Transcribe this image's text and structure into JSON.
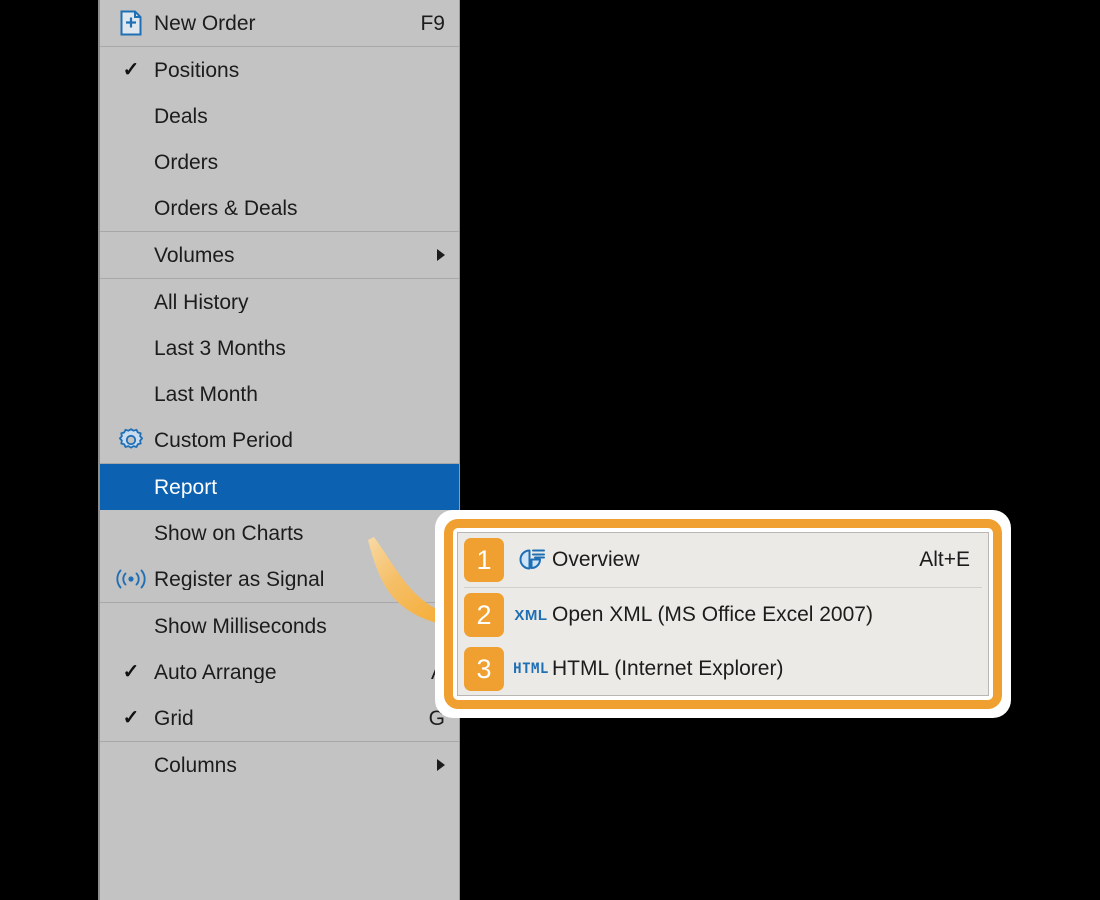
{
  "colors": {
    "menu_background": "#c3c3c3",
    "menu_separator": "#a8a8a8",
    "selection_blue": "#0c62b0",
    "accent_orange": "#f0a030",
    "icon_blue": "#1f6fb5",
    "submenu_background": "#eceae6",
    "canvas_black": "#000000",
    "text": "#1c1c1c"
  },
  "menu": {
    "name": "trade-context-menu",
    "groups": [
      {
        "items": [
          {
            "label": "New Order",
            "accel": "F9",
            "icon": "new-document-plus-icon",
            "checked": false,
            "submenu": false,
            "selected": false
          }
        ]
      },
      {
        "items": [
          {
            "label": "Positions",
            "accel": "",
            "icon": "",
            "checked": true,
            "submenu": false,
            "selected": false
          },
          {
            "label": "Deals",
            "accel": "",
            "icon": "",
            "checked": false,
            "submenu": false,
            "selected": false
          },
          {
            "label": "Orders",
            "accel": "",
            "icon": "",
            "checked": false,
            "submenu": false,
            "selected": false
          },
          {
            "label": "Orders & Deals",
            "accel": "",
            "icon": "",
            "checked": false,
            "submenu": false,
            "selected": false
          }
        ]
      },
      {
        "items": [
          {
            "label": "Volumes",
            "accel": "",
            "icon": "",
            "checked": false,
            "submenu": true,
            "selected": false
          }
        ]
      },
      {
        "items": [
          {
            "label": "All History",
            "accel": "",
            "icon": "",
            "checked": false,
            "submenu": false,
            "selected": false
          },
          {
            "label": "Last 3 Months",
            "accel": "",
            "icon": "",
            "checked": false,
            "submenu": false,
            "selected": false
          },
          {
            "label": "Last Month",
            "accel": "",
            "icon": "",
            "checked": false,
            "submenu": false,
            "selected": false
          },
          {
            "label": "Custom Period",
            "accel": "",
            "icon": "gear-icon",
            "checked": false,
            "submenu": false,
            "selected": false
          }
        ]
      },
      {
        "items": [
          {
            "label": "Report",
            "accel": "",
            "icon": "",
            "checked": false,
            "submenu": false,
            "selected": true
          },
          {
            "label": "Show on Charts",
            "accel": "",
            "icon": "",
            "checked": false,
            "submenu": false,
            "selected": false
          },
          {
            "label": "Register as Signal",
            "accel": "",
            "icon": "signal-broadcast-icon",
            "checked": false,
            "submenu": false,
            "selected": false
          }
        ]
      },
      {
        "items": [
          {
            "label": "Show Milliseconds",
            "accel": "",
            "icon": "",
            "checked": false,
            "submenu": false,
            "selected": false
          },
          {
            "label": "Auto Arrange",
            "accel": "A",
            "icon": "",
            "checked": true,
            "submenu": false,
            "selected": false
          },
          {
            "label": "Grid",
            "accel": "G",
            "icon": "",
            "checked": true,
            "submenu": false,
            "selected": false
          }
        ]
      },
      {
        "items": [
          {
            "label": "Columns",
            "accel": "",
            "icon": "",
            "checked": false,
            "submenu": true,
            "selected": false
          }
        ]
      }
    ]
  },
  "submenu": {
    "name": "report-submenu",
    "items": [
      {
        "badge": "1",
        "icon": "report-chart-icon",
        "icon_text": "",
        "label": "Overview",
        "accel": "Alt+E"
      },
      {
        "badge": "2",
        "icon": "xml-file-icon",
        "icon_text": "XML",
        "label": "Open XML (MS Office Excel 2007)",
        "accel": ""
      },
      {
        "badge": "3",
        "icon": "html-file-icon",
        "icon_text": "HTML",
        "label": "HTML (Internet Explorer)",
        "accel": ""
      }
    ]
  },
  "annotation": {
    "arrow": "curved-orange-arrow",
    "callout": "orange-rounded-highlight-border"
  }
}
